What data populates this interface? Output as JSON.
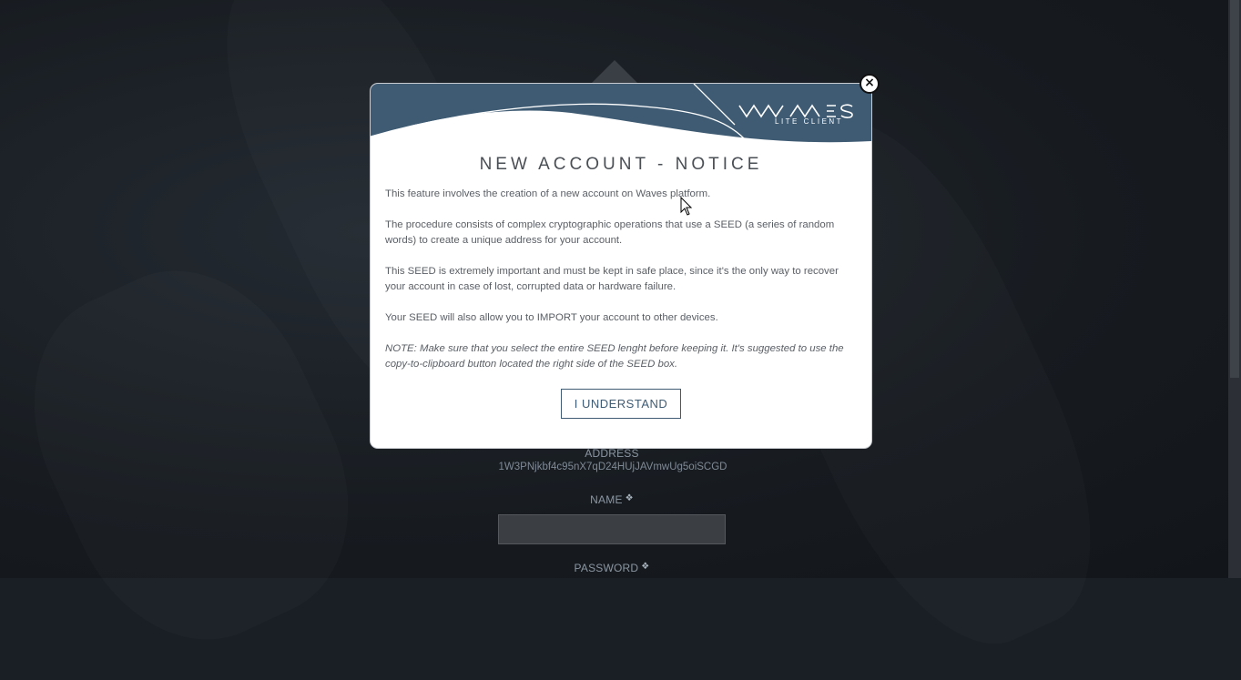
{
  "modal": {
    "title": "NEW ACCOUNT - NOTICE",
    "close_symbol": "×",
    "logo": {
      "main": "WAVES",
      "sub": "LITE CLIENT"
    },
    "paragraphs": [
      "This feature involves the creation of a new account on Waves platform.",
      "The procedure consists of complex cryptographic operations that use a SEED (a series of random words) to create a unique address for your account.",
      "This SEED is extremely important and must be kept in safe place, since it's the only way to recover your account in case of lost, corrupted data or hardware failure.",
      "Your SEED will also allow you to IMPORT your account to other devices."
    ],
    "note": "NOTE: Make sure that you select the entire SEED lenght before keeping it. It's suggested to use the copy-to-clipboard button located the right side of the SEED box.",
    "confirm_button": "I UNDERSTAND"
  },
  "form": {
    "address_label": "ADDRESS",
    "address_value": "1W3PNjkbf4c95nX7qD24HUjJAVmwUg5oiSCGD",
    "name_label": "NAME",
    "password_label": "PASSWORD",
    "help_icon": "❖"
  },
  "colors": {
    "header_blue": "#3e5b73",
    "background": "#1a1f25"
  }
}
